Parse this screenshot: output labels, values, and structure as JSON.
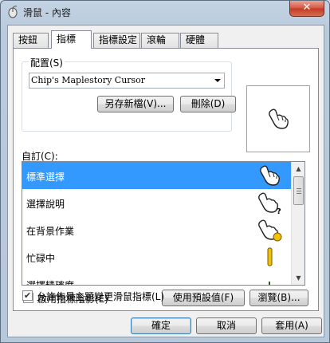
{
  "window": {
    "title": "滑鼠 - 內容",
    "close_label": "✕"
  },
  "tabs": [
    {
      "label": "按鈕"
    },
    {
      "label": "指標"
    },
    {
      "label": "指標設定"
    },
    {
      "label": "滾輪"
    },
    {
      "label": "硬體"
    }
  ],
  "scheme": {
    "group_label": "配置(S)",
    "selected": "Chip's Maplestory Cursor",
    "save_as_label": "另存新檔(V)...",
    "delete_label": "刪除(D)"
  },
  "customize": {
    "label": "自訂(C):",
    "items": [
      {
        "label": "標準選擇"
      },
      {
        "label": "選擇說明"
      },
      {
        "label": "在背景作業"
      },
      {
        "label": "忙碌中"
      },
      {
        "label": "選擇精確度"
      }
    ]
  },
  "options": {
    "shadow_label": "啟用指標陰影(E)",
    "shadow_checked": true,
    "use_default_label": "使用預設值(F)",
    "browse_label": "瀏覽(B)...",
    "themes_label": "允許佈景主題變更滑鼠指標(L)",
    "themes_checked": true
  },
  "footer": {
    "ok_label": "確定",
    "cancel_label": "取消",
    "apply_label": "套用(A)"
  },
  "colors": {
    "selection": "#3399ff",
    "close_button": "#c9462c",
    "frame": "#b9cadc"
  }
}
